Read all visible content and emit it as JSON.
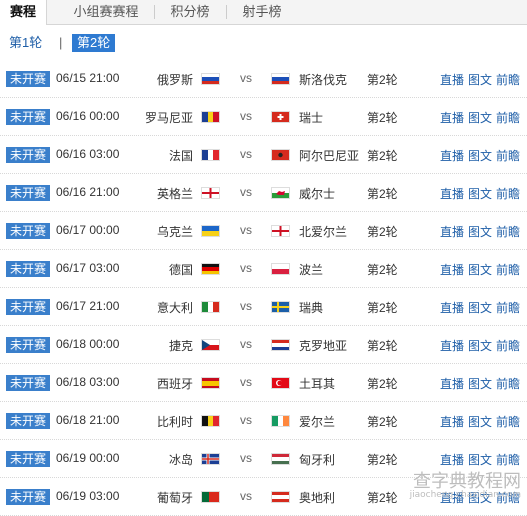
{
  "tabs": [
    "赛程",
    "小组赛赛程",
    "积分榜",
    "射手榜"
  ],
  "rounds": {
    "r1": "第1轮",
    "sep": "|",
    "r2": "第2轮"
  },
  "vs_label": "vs",
  "links": {
    "live": "直播",
    "text": "图文",
    "preview": "前瞻"
  },
  "matches": [
    {
      "status": "未开赛",
      "time": "06/15 21:00",
      "home": "俄罗斯",
      "away": "斯洛伐克",
      "round": "第2轮",
      "home_flag": "russia-flag-icon",
      "away_flag": "slovakia-flag-icon"
    },
    {
      "status": "未开赛",
      "time": "06/16 00:00",
      "home": "罗马尼亚",
      "away": "瑞士",
      "round": "第2轮",
      "home_flag": "romania-flag-icon",
      "away_flag": "switzerland-flag-icon"
    },
    {
      "status": "未开赛",
      "time": "06/16 03:00",
      "home": "法国",
      "away": "阿尔巴尼亚",
      "round": "第2轮",
      "home_flag": "france-flag-icon",
      "away_flag": "albania-flag-icon"
    },
    {
      "status": "未开赛",
      "time": "06/16 21:00",
      "home": "英格兰",
      "away": "威尔士",
      "round": "第2轮",
      "home_flag": "england-flag-icon",
      "away_flag": "wales-flag-icon"
    },
    {
      "status": "未开赛",
      "time": "06/17 00:00",
      "home": "乌克兰",
      "away": "北爱尔兰",
      "round": "第2轮",
      "home_flag": "ukraine-flag-icon",
      "away_flag": "northern-ireland-flag-icon"
    },
    {
      "status": "未开赛",
      "time": "06/17 03:00",
      "home": "德国",
      "away": "波兰",
      "round": "第2轮",
      "home_flag": "germany-flag-icon",
      "away_flag": "poland-flag-icon"
    },
    {
      "status": "未开赛",
      "time": "06/17 21:00",
      "home": "意大利",
      "away": "瑞典",
      "round": "第2轮",
      "home_flag": "italy-flag-icon",
      "away_flag": "sweden-flag-icon"
    },
    {
      "status": "未开赛",
      "time": "06/18 00:00",
      "home": "捷克",
      "away": "克罗地亚",
      "round": "第2轮",
      "home_flag": "czech-flag-icon",
      "away_flag": "croatia-flag-icon"
    },
    {
      "status": "未开赛",
      "time": "06/18 03:00",
      "home": "西班牙",
      "away": "土耳其",
      "round": "第2轮",
      "home_flag": "spain-flag-icon",
      "away_flag": "turkey-flag-icon"
    },
    {
      "status": "未开赛",
      "time": "06/18 21:00",
      "home": "比利时",
      "away": "爱尔兰",
      "round": "第2轮",
      "home_flag": "belgium-flag-icon",
      "away_flag": "ireland-flag-icon"
    },
    {
      "status": "未开赛",
      "time": "06/19 00:00",
      "home": "冰岛",
      "away": "匈牙利",
      "round": "第2轮",
      "home_flag": "iceland-flag-icon",
      "away_flag": "hungary-flag-icon"
    },
    {
      "status": "未开赛",
      "time": "06/19 03:00",
      "home": "葡萄牙",
      "away": "奥地利",
      "round": "第2轮",
      "home_flag": "portugal-flag-icon",
      "away_flag": "austria-flag-icon"
    }
  ],
  "watermark": {
    "line1": "查字典教程网",
    "line2": "jiaocheng.chazidian.com"
  },
  "colors": {
    "status_bg": "#3a7fcb",
    "link": "#1f5fa8",
    "active_round_bg": "#2e7ad1"
  }
}
